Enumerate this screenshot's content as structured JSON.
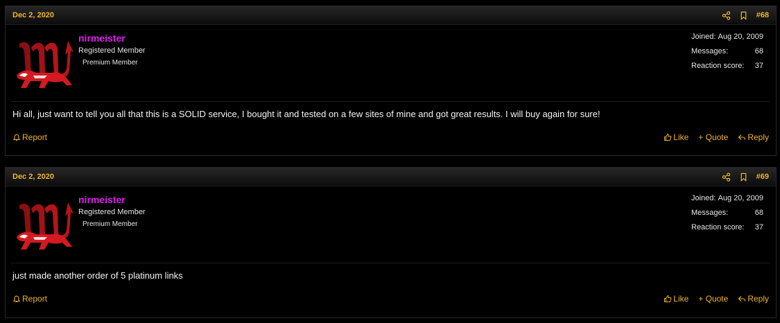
{
  "posts": [
    {
      "date": "Dec 2, 2020",
      "number": "#68",
      "username": "nirmeister",
      "user_title": "Registered Member",
      "user_banner": "Premium Member",
      "stats": {
        "joined_label": "Joined:",
        "joined_value": "Aug 20, 2009",
        "messages_label": "Messages:",
        "messages_value": "68",
        "reaction_label": "Reaction score:",
        "reaction_value": "37"
      },
      "message": "Hi all, just want to tell you all that this is a SOLID service, I bought it and tested on a few sites of mine and got great results. I will buy again for sure!",
      "report_label": "Report",
      "like_label": "Like",
      "quote_label": "+ Quote",
      "reply_label": "Reply"
    },
    {
      "date": "Dec 2, 2020",
      "number": "#69",
      "username": "nirmeister",
      "user_title": "Registered Member",
      "user_banner": "Premium Member",
      "stats": {
        "joined_label": "Joined:",
        "joined_value": "Aug 20, 2009",
        "messages_label": "Messages:",
        "messages_value": "68",
        "reaction_label": "Reaction score:",
        "reaction_value": "37"
      },
      "message": "just made another order of 5 platinum links",
      "report_label": "Report",
      "like_label": "Like",
      "quote_label": "+ Quote",
      "reply_label": "Reply"
    }
  ],
  "colors": {
    "accent": "#f0b429",
    "username": "#e01ef0",
    "avatar_red": "#c4161c"
  },
  "icons": [
    "share-icon",
    "bookmark-icon",
    "bell-icon",
    "thumbs-up-icon",
    "reply-icon",
    "avatar-logo"
  ]
}
